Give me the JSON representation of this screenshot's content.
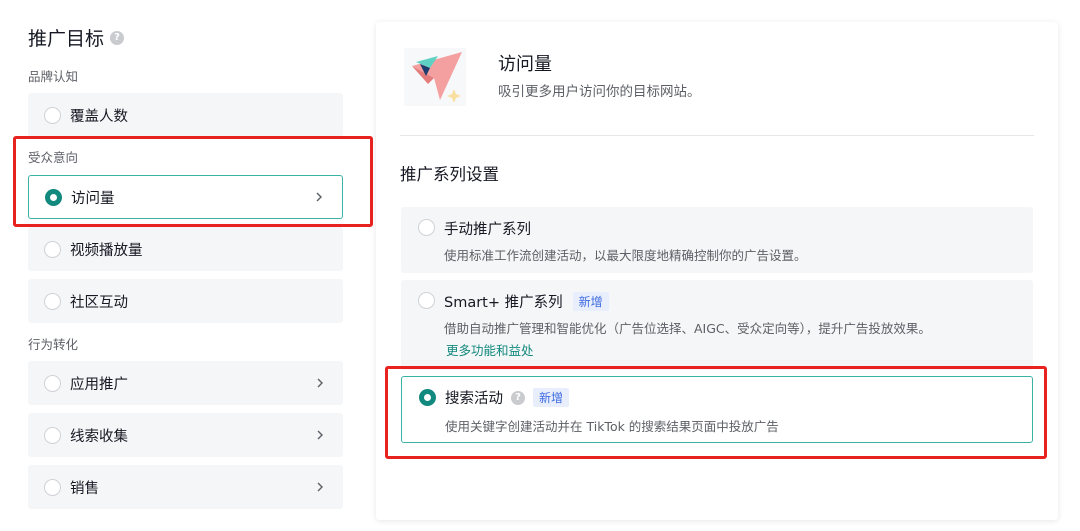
{
  "objective": {
    "title": "推广目标",
    "groups": {
      "brand": "品牌认知",
      "audience": "受众意向",
      "conversion": "行为转化"
    },
    "options": {
      "reach": "覆盖人数",
      "traffic": "访问量",
      "video_views": "视频播放量",
      "community": "社区互动",
      "app_promotion": "应用推广",
      "lead_gen": "线索收集",
      "sales": "销售"
    }
  },
  "detail": {
    "title": "访问量",
    "description": "吸引更多用户访问你的目标网站。",
    "section_title": "推广系列设置",
    "cards": {
      "manual": {
        "title": "手动推广系列",
        "desc": "使用标准工作流创建活动，以最大限度地精确控制你的广告设置。"
      },
      "smart": {
        "title": "Smart+ 推广系列",
        "badge": "新增",
        "desc": "借助自动推广管理和智能优化（广告位选择、AIGC、受众定向等），提升广告投放效果。",
        "link": "更多功能和益处"
      },
      "search": {
        "title": "搜索活动",
        "badge": "新增",
        "desc": "使用关键字创建活动并在 TikTok 的搜索结果页面中投放广告"
      }
    }
  },
  "colors": {
    "accent": "#11897e",
    "highlight_border": "#e8221f",
    "badge_text": "#3d6ae0"
  }
}
